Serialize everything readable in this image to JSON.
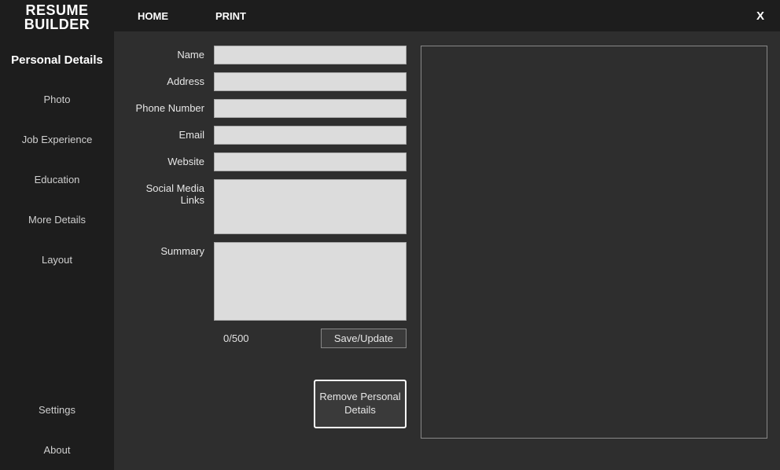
{
  "app": {
    "title_line1": "RESUME",
    "title_line2": "BUILDER"
  },
  "topbar": {
    "home": "HOME",
    "print": "PRINT",
    "close": "X"
  },
  "sidebar": {
    "items": [
      {
        "key": "personal-details",
        "label": "Personal Details",
        "active": true
      },
      {
        "key": "photo",
        "label": "Photo",
        "active": false
      },
      {
        "key": "job-experience",
        "label": "Job Experience",
        "active": false
      },
      {
        "key": "education",
        "label": "Education",
        "active": false
      },
      {
        "key": "more-details",
        "label": "More Details",
        "active": false
      },
      {
        "key": "layout",
        "label": "Layout",
        "active": false
      }
    ],
    "bottom_items": [
      {
        "key": "settings",
        "label": "Settings"
      },
      {
        "key": "about",
        "label": "About"
      }
    ]
  },
  "form": {
    "fields": {
      "name": {
        "label": "Name",
        "value": ""
      },
      "address": {
        "label": "Address",
        "value": ""
      },
      "phone": {
        "label": "Phone Number",
        "value": ""
      },
      "email": {
        "label": "Email",
        "value": ""
      },
      "website": {
        "label": "Website",
        "value": ""
      },
      "social": {
        "label": "Social Media Links",
        "value": ""
      },
      "summary": {
        "label": "Summary",
        "value": ""
      }
    },
    "summary_counter": "0/500",
    "save_label": "Save/Update",
    "remove_label": "Remove Personal Details"
  }
}
